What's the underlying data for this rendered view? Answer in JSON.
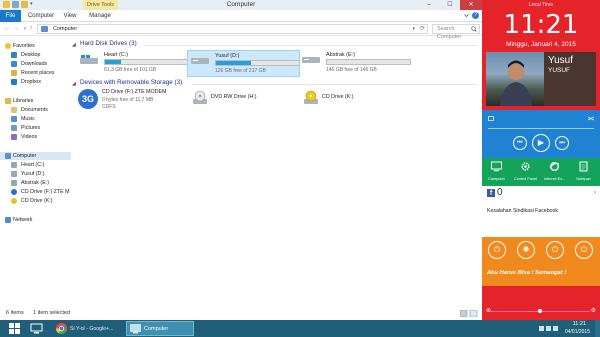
{
  "window": {
    "title": "Computer",
    "context_tab": "Drive Tools",
    "controls": {
      "minimize": "–",
      "maximize": "☐",
      "close": "✕"
    }
  },
  "ribbon": {
    "tabs": [
      "File",
      "Computer",
      "View",
      "Manage"
    ],
    "help": "?"
  },
  "address": {
    "path": "Computer",
    "search_placeholder": "Search Computer"
  },
  "nav": {
    "favorites": "Favorites",
    "favorites_items": [
      "Desktop",
      "Downloads",
      "Recent places",
      "Dropbox"
    ],
    "libraries": "Libraries",
    "libraries_items": [
      "Documents",
      "Music",
      "Pictures",
      "Videos"
    ],
    "computer": "Computer",
    "computer_items": [
      "Heart (C:)",
      "Yusuf (D:)",
      "Abstrak (E:)",
      "CD Drive (F:) ZTE M",
      "CD Drive (K:)"
    ],
    "network": "Network"
  },
  "content": {
    "hdd_header": "Hard Disk Drives (3)",
    "removable_header": "Devices with Removable Storage (3)",
    "drives": [
      {
        "name": "Heart (C:)",
        "size": "81,3 GB free of 101 GB",
        "used": 0.195
      },
      {
        "name": "Yusuf (D:)",
        "size": "126 GB free of 217 GB",
        "used": 0.42
      },
      {
        "name": "Abstrak (E:)",
        "size": "146 GB free of 146 GB",
        "used": 0.0
      }
    ],
    "removable": [
      {
        "name": "CD Drive (F:) ZTE MODEM",
        "line2": "0 bytes free of 11,7 MB",
        "line3": "CDFS"
      },
      {
        "name": "DVD RW Drive (H:)",
        "line2": "",
        "line3": ""
      },
      {
        "name": "CD Drive (K:)",
        "line2": "",
        "line3": ""
      }
    ]
  },
  "status": {
    "count": "6 items",
    "selected": "1 item selected"
  },
  "sidebar": {
    "clock_label": "Local Time",
    "time": "11:21",
    "date": "Minggu, Januari 4, 2015",
    "user_name": "Yusuf",
    "user_sub": "YUSUF",
    "media": {
      "prev": "⏮",
      "play": "▶",
      "next": "⏭"
    },
    "apps": [
      "Computer",
      "Control Panel",
      "Internet Ex...",
      "Notepad"
    ],
    "fb_logo": "f",
    "fb_count": "0",
    "fb_arrow": "›",
    "fb_text": "Kesalahan Sindikasi Facebook",
    "power": {
      "p1": "⏻",
      "p2": "✺",
      "p3": "⏻",
      "p4": "⏻"
    },
    "motto": "Aku Harus Bisa ! Semangat !"
  },
  "taskbar": {
    "chrome_label": "Si Y-ol - Google+...",
    "computer_label": "Computer",
    "tray_time": "11:21",
    "tray_date": "04/01/2015"
  },
  "colors": {
    "sidebar_red": "#e4232b",
    "media_blue": "#1f82d2",
    "apps_green": "#14a35a",
    "power_orange": "#f08a1e",
    "taskbar": "#1f5f7a",
    "selection": "#cce8ff",
    "file_tab": "#1979ca",
    "drive_fill": "#26a0da"
  }
}
